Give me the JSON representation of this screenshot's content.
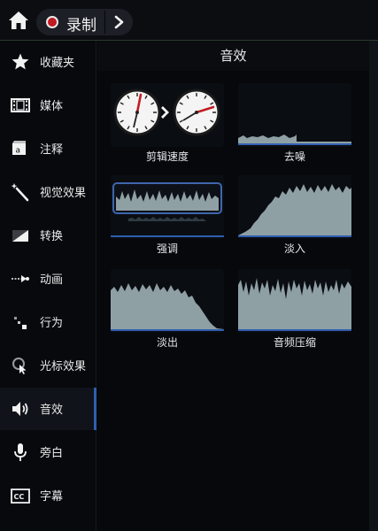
{
  "toolbar": {
    "record_label": "录制"
  },
  "sidebar": {
    "items": [
      {
        "label": "收藏夹",
        "icon": "star-icon"
      },
      {
        "label": "媒体",
        "icon": "film-icon"
      },
      {
        "label": "注释",
        "icon": "annotation-icon"
      },
      {
        "label": "视觉效果",
        "icon": "magic-wand-icon"
      },
      {
        "label": "转换",
        "icon": "transition-icon"
      },
      {
        "label": "动画",
        "icon": "animation-icon"
      },
      {
        "label": "行为",
        "icon": "behavior-icon"
      },
      {
        "label": "光标效果",
        "icon": "cursor-effect-icon"
      },
      {
        "label": "音效",
        "icon": "speaker-icon",
        "active": true
      },
      {
        "label": "旁白",
        "icon": "microphone-icon"
      },
      {
        "label": "字幕",
        "icon": "captions-icon"
      }
    ]
  },
  "panel": {
    "title": "音效",
    "effects": [
      {
        "label": "剪辑速度"
      },
      {
        "label": "去噪"
      },
      {
        "label": "强调"
      },
      {
        "label": "淡入"
      },
      {
        "label": "淡出"
      },
      {
        "label": "音频压缩"
      }
    ]
  },
  "colors": {
    "accent": "#2f5fb0",
    "record": "#c01a22",
    "waveform": "#8fa0a5"
  }
}
